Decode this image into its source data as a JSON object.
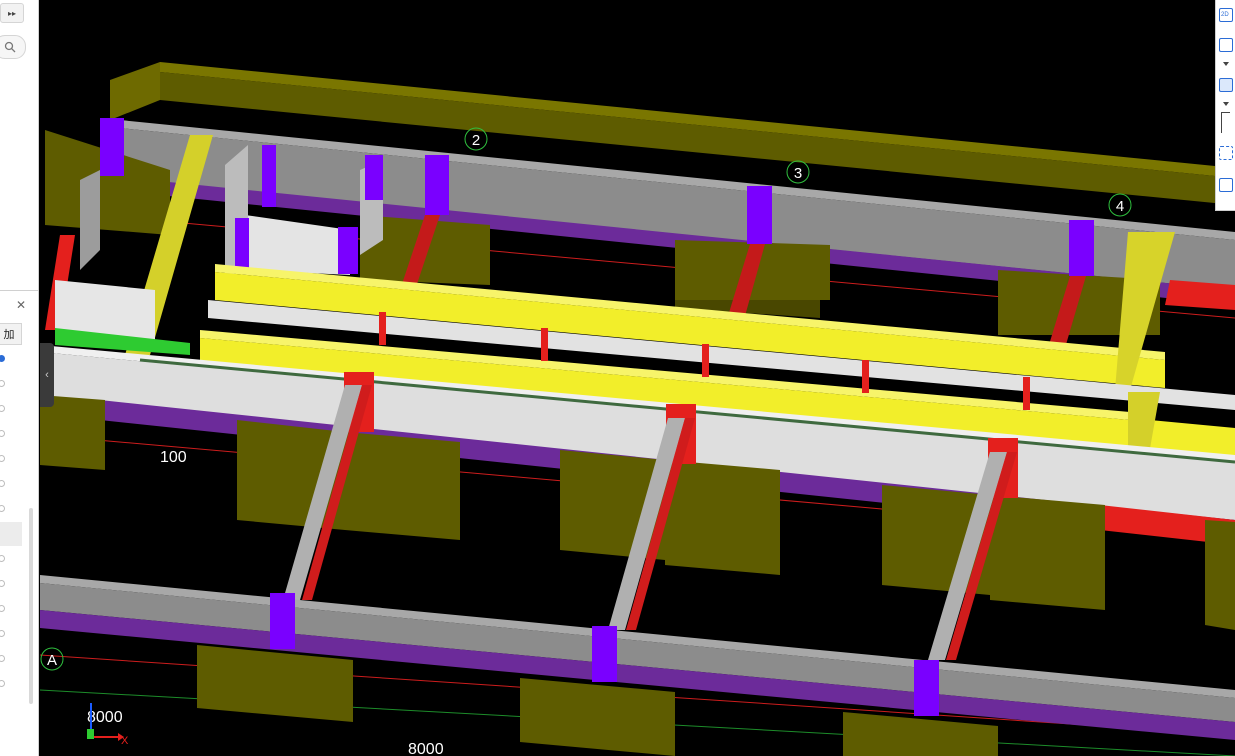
{
  "sidebar": {
    "expand_glyph": "▸▸",
    "search_icon": "search-icon",
    "panel_close_glyph": "✕",
    "panel_tab_label": "加",
    "radio_count": 14,
    "radio_selected_index": 0
  },
  "viewport": {
    "grid_labels": {
      "axis_2": "2",
      "axis_3": "3",
      "axis_4": "4",
      "axis_a": "A"
    },
    "dimensions": {
      "d100": "100",
      "d8000_left": "8000",
      "d8000_bottom": "8000"
    },
    "axis_indicator": {
      "x_label": "X"
    },
    "collapse_glyph": "‹"
  },
  "toolbar": {
    "view2d_label": "2D",
    "buttons": [
      "view-2d",
      "view-front",
      "view-3d-box",
      "view-corner",
      "view-iso",
      "view-list"
    ]
  },
  "colors": {
    "background": "#000000",
    "footing": "#5e5c00",
    "beam_gray": "#8c8c8c",
    "slab_white": "#dedede",
    "column_purple": "#7a00ff",
    "red_member": "#e4201d",
    "yellow_beam": "#f2ee2a",
    "green_member": "#2ecb31",
    "grid_circle": "#2fbf3e"
  }
}
